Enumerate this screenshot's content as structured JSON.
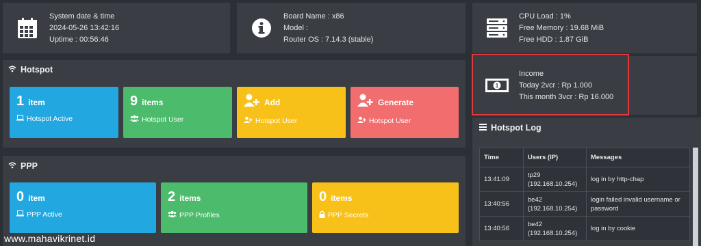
{
  "system": {
    "label": "System date & time",
    "datetime": "2024-05-26 13:42:16",
    "uptime": "Uptime : 00:56:46"
  },
  "board": {
    "name": "Board Name : x86",
    "model": "Model :",
    "os": "Router OS : 7.14.3 (stable)"
  },
  "resources": {
    "cpu": "CPU Load : 1%",
    "memory": "Free Memory : 19.68 MiB",
    "hdd": "Free HDD : 1.87 GiB"
  },
  "income": {
    "title": "Income",
    "today": "Today 2vcr : Rp 1.000",
    "month": "This month 3vcr : Rp 16.000"
  },
  "hotspot": {
    "title": "Hotspot",
    "tiles": [
      {
        "num": "1",
        "unit": "item",
        "sub": "Hotspot Active"
      },
      {
        "num": "9",
        "unit": "items",
        "sub": "Hotspot User"
      },
      {
        "num": "",
        "unit": "Add",
        "sub": "Hotspot User"
      },
      {
        "num": "",
        "unit": "Generate",
        "sub": "Hotspot User"
      }
    ]
  },
  "ppp": {
    "title": "PPP",
    "tiles": [
      {
        "num": "0",
        "unit": "item",
        "sub": "PPP Active"
      },
      {
        "num": "2",
        "unit": "items",
        "sub": "PPP Profiles"
      },
      {
        "num": "0",
        "unit": "items",
        "sub": "PPP Secrets"
      }
    ]
  },
  "log": {
    "title": "Hotspot Log",
    "headers": {
      "time": "Time",
      "users": "Users (IP)",
      "messages": "Messages"
    },
    "rows": [
      {
        "time": "13:41:09",
        "user": "tp29",
        "ip": "(192.168.10.254)",
        "msg": "log in by http-chap"
      },
      {
        "time": "13:40:56",
        "user": "be42",
        "ip": "(192.168.10.254)",
        "msg": "login failed invalid username or password"
      },
      {
        "time": "13:40:56",
        "user": "be42",
        "ip": "(192.168.10.254)",
        "msg": "log in by cookie"
      }
    ]
  },
  "watermark": "www.mahavikrinet.id",
  "colors": {
    "blue": "#22a7e0",
    "green": "#4cbb6c",
    "yellow": "#f8c11a",
    "red": "#f26d6d",
    "highlight": "#e23a3a"
  }
}
